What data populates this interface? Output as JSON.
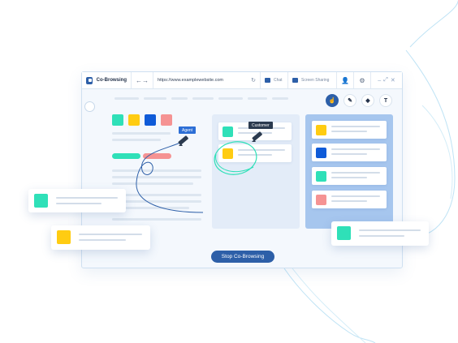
{
  "app": {
    "name": "Co-Browsing"
  },
  "nav": {
    "back_icon": "arrow-left-icon",
    "forward_icon": "arrow-right-icon"
  },
  "address_bar": {
    "url": "https://www.examplewebsite.com",
    "refresh_icon": "refresh-icon"
  },
  "tabs": [
    {
      "label": "Chat",
      "icon": "chat-icon"
    },
    {
      "label": "Screen Sharing",
      "icon": "screen-icon"
    }
  ],
  "annotation_tools": [
    {
      "icon": "pointer-icon",
      "glyph": "☝",
      "active": true
    },
    {
      "icon": "pen-icon",
      "glyph": "✎",
      "active": false
    },
    {
      "icon": "eraser-icon",
      "glyph": "◆",
      "active": false
    },
    {
      "icon": "text-tool-icon",
      "glyph": "T",
      "active": false
    }
  ],
  "labels": {
    "agent": "Agent",
    "customer": "Customer"
  },
  "stop_button": {
    "label": "Stop Co-Browsing"
  },
  "colors": {
    "accent": "#2d5fa8",
    "teal": "#2fe0b8",
    "yellow": "#ffcc12",
    "blue": "#0f5bd8",
    "salmon": "#f59393",
    "lavender": "#a6c6ee"
  }
}
